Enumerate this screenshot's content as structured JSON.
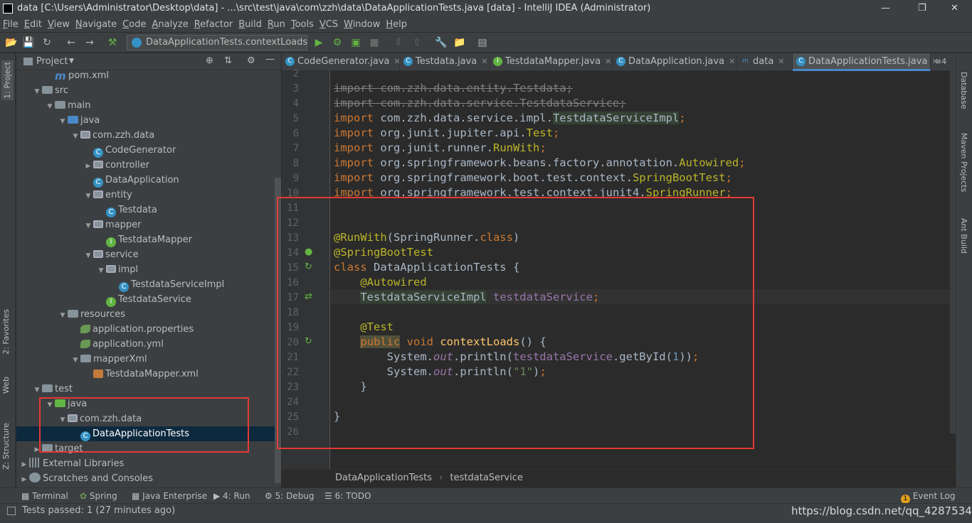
{
  "title": "data [C:\\Users\\Administrator\\Desktop\\data] - ...\\src\\test\\java\\com\\zzh\\data\\DataApplicationTests.java [data] - IntelliJ IDEA (Administrator)",
  "menu": [
    "File",
    "Edit",
    "View",
    "Navigate",
    "Code",
    "Analyze",
    "Refactor",
    "Build",
    "Run",
    "Tools",
    "VCS",
    "Window",
    "Help"
  ],
  "run_config": "DataApplicationTests.contextLoads",
  "left_tool_tabs": [
    "1: Project",
    "2: Favorites",
    "Web",
    "Z: Structure"
  ],
  "right_tool_tabs": [
    "Database",
    "Maven Projects",
    "Ant Build"
  ],
  "project_header": "Project",
  "tree": [
    {
      "label": "pom.xml",
      "icon": "m"
    },
    {
      "label": "src",
      "icon": "folder"
    },
    {
      "label": "main",
      "icon": "folder"
    },
    {
      "label": "java",
      "icon": "folderb"
    },
    {
      "label": "com.zzh.data",
      "icon": "pkg"
    },
    {
      "label": "CodeGenerator",
      "icon": "cls"
    },
    {
      "label": "controller",
      "icon": "pkg"
    },
    {
      "label": "DataApplication",
      "icon": "cls"
    },
    {
      "label": "entity",
      "icon": "pkg"
    },
    {
      "label": "Testdata",
      "icon": "cls"
    },
    {
      "label": "mapper",
      "icon": "pkg"
    },
    {
      "label": "TestdataMapper",
      "icon": "intf"
    },
    {
      "label": "service",
      "icon": "pkg"
    },
    {
      "label": "impl",
      "icon": "pkg"
    },
    {
      "label": "TestdataServiceImpl",
      "icon": "cls"
    },
    {
      "label": "TestdataService",
      "icon": "intf"
    },
    {
      "label": "resources",
      "icon": "folder"
    },
    {
      "label": "application.properties",
      "icon": "leaf"
    },
    {
      "label": "application.yml",
      "icon": "leaf"
    },
    {
      "label": "mapperXml",
      "icon": "folder"
    },
    {
      "label": "TestdataMapper.xml",
      "icon": "xml"
    },
    {
      "label": "test",
      "icon": "folder"
    },
    {
      "label": "java",
      "icon": "folderg"
    },
    {
      "label": "com.zzh.data",
      "icon": "pkg"
    },
    {
      "label": "DataApplicationTests",
      "icon": "cls"
    },
    {
      "label": "target",
      "icon": "folder"
    },
    {
      "label": "External Libraries",
      "icon": "lib"
    },
    {
      "label": "Scratches and Consoles",
      "icon": "scr"
    }
  ],
  "tabs": [
    "CodeGenerator.java",
    "Testdata.java",
    "TestdataMapper.java",
    "DataApplication.java",
    "data",
    "DataApplicationTests.java"
  ],
  "tab_overflow": "≡4",
  "line_numbers": [
    "2",
    "3",
    "4",
    "5",
    "6",
    "7",
    "8",
    "9",
    "10",
    "11",
    "12",
    "13",
    "14",
    "15",
    "16",
    "17",
    "18",
    "19",
    "20",
    "21",
    "22",
    "23",
    "24",
    "25",
    "26"
  ],
  "breadcrumb": [
    "DataApplicationTests",
    "testdataService"
  ],
  "bottom_tabs": [
    "Terminal",
    "Spring",
    "Java Enterprise",
    "4: Run",
    "5: Debug",
    "6: TODO"
  ],
  "event_log": "Event Log",
  "status_text": "Tests passed: 1 (27 minutes ago)",
  "watermark": "https://blog.csdn.net/qq_42875345",
  "colors": {
    "accent": "#4a88c7",
    "highlight_box": "#e53935"
  }
}
